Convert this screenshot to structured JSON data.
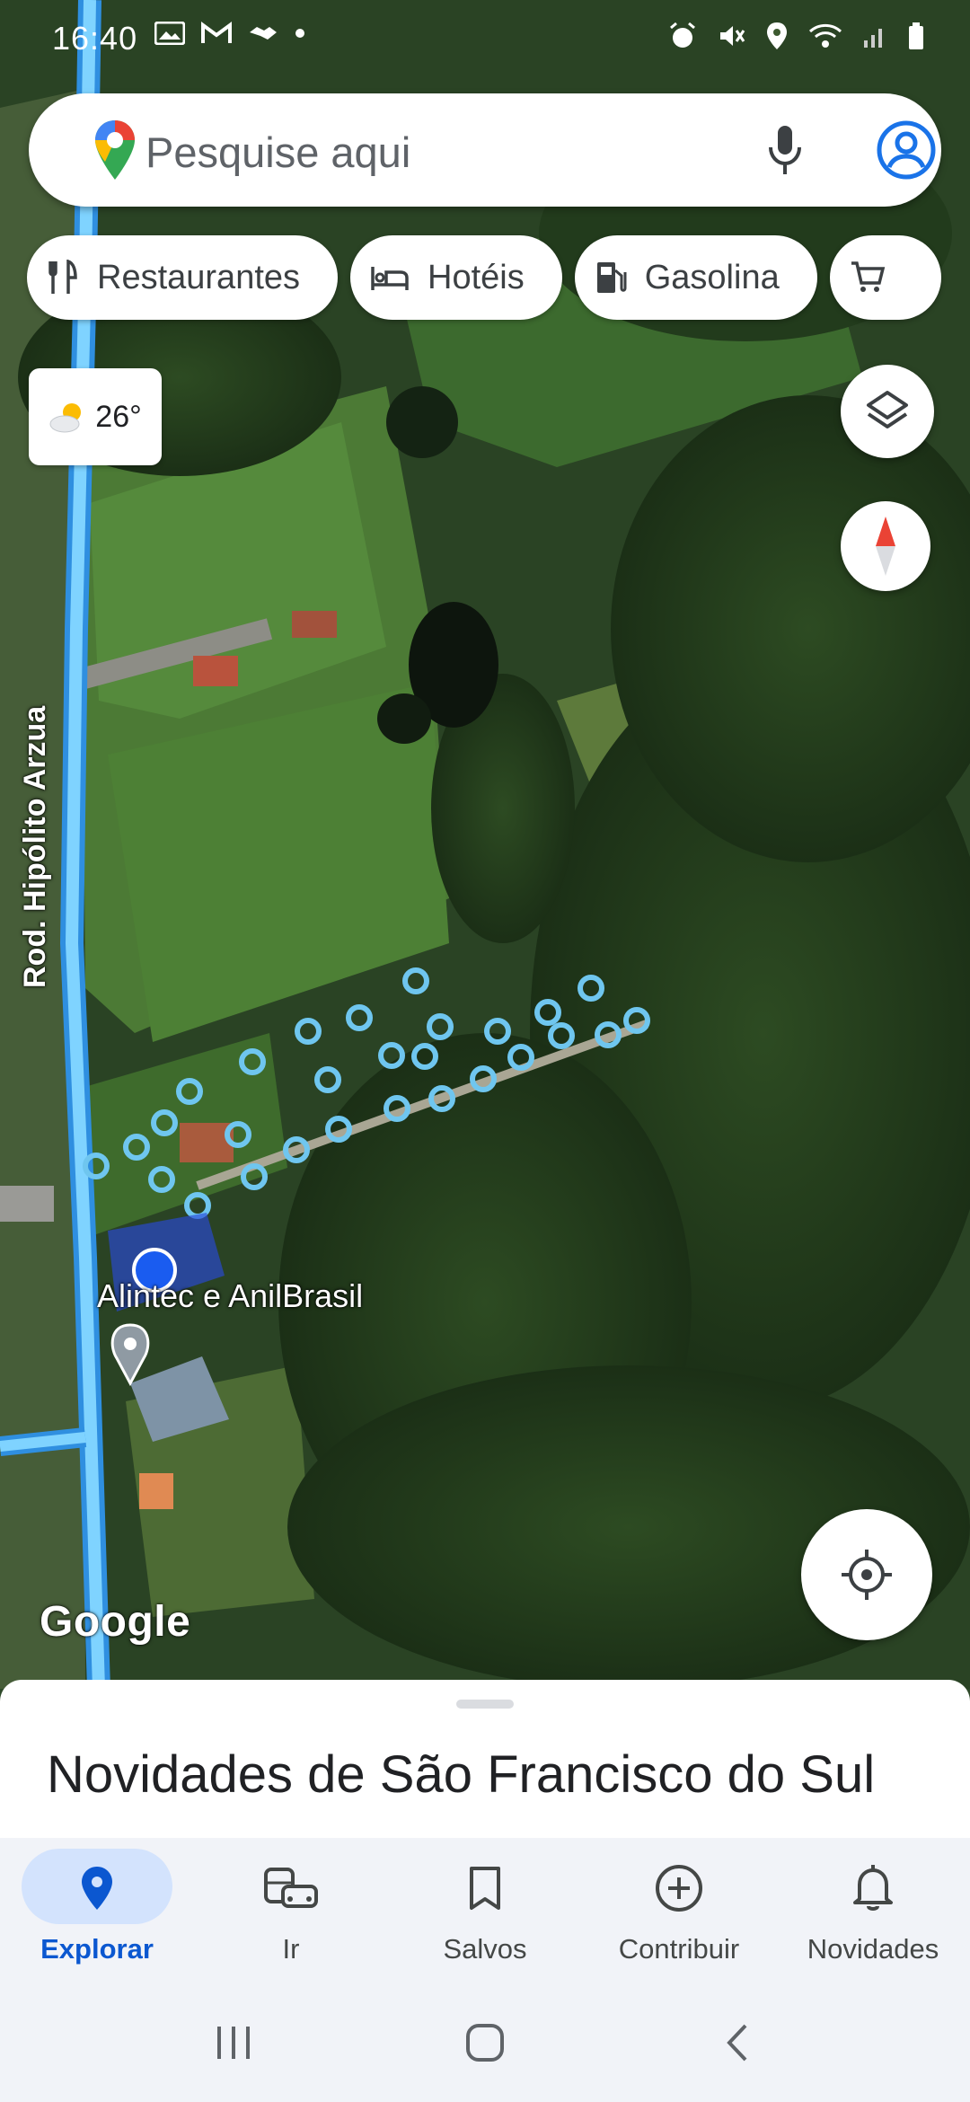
{
  "status_bar": {
    "time": "16:40",
    "left_icons": [
      "gallery-icon",
      "gmail-icon",
      "handshake-icon",
      "dot-icon"
    ],
    "right_icons": [
      "alarm-icon",
      "mute-icon",
      "location-icon",
      "wifi-icon",
      "signal-icon",
      "battery-icon"
    ]
  },
  "search": {
    "placeholder": "Pesquise aqui",
    "icons": [
      "maps-pin-icon",
      "mic-icon",
      "account-icon"
    ]
  },
  "chips": [
    {
      "label": "Restaurantes",
      "icon": "fork-knife-icon"
    },
    {
      "label": "Hotéis",
      "icon": "bed-icon"
    },
    {
      "label": "Gasolina",
      "icon": "fuel-icon"
    },
    {
      "label": "",
      "icon": "cart-icon"
    }
  ],
  "weather": {
    "temp": "26°",
    "icon": "partly-cloudy-icon"
  },
  "map": {
    "road_label": "Rod. Hipólito Arzua",
    "place_label": "Alintec e AnilBrasil",
    "watermark": "Google",
    "colors": {
      "road": "#4fc3f7",
      "location_dot": "#1a73e8"
    }
  },
  "map_controls": [
    "layers-icon",
    "compass-icon",
    "my-location-icon"
  ],
  "sheet": {
    "title": "Novidades de São Francisco do Sul"
  },
  "bottom_nav": [
    {
      "label": "Explorar",
      "icon": "explore-pin-icon",
      "active": true
    },
    {
      "label": "Ir",
      "icon": "commute-icon",
      "active": false
    },
    {
      "label": "Salvos",
      "icon": "bookmark-icon",
      "active": false
    },
    {
      "label": "Contribuir",
      "icon": "add-circle-icon",
      "active": false
    },
    {
      "label": "Novidades",
      "icon": "bell-icon",
      "active": false
    }
  ],
  "system_nav": [
    "recents-icon",
    "home-icon",
    "back-icon"
  ],
  "colors": {
    "accent": "#0b57d0",
    "active_pill": "#d3e3fd",
    "nav_bg": "#f1f3f8"
  }
}
